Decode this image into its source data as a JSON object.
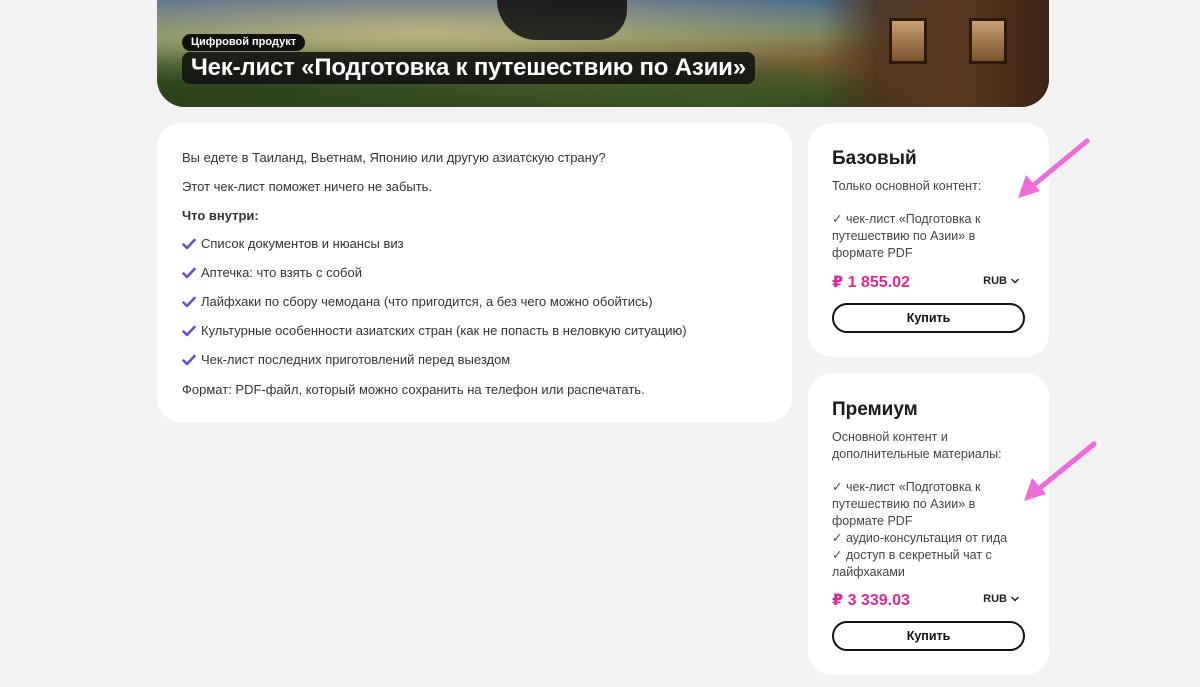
{
  "hero": {
    "tag": "Цифровой продукт",
    "title": "Чек-лист «Подготовка к путешествию по Азии»"
  },
  "description": {
    "intro": "Вы едете в Таиланд, Вьетнам, Японию или другую азиатскую страну?",
    "purpose": "Этот чек-лист поможет ничего не забыть.",
    "inside_heading": "Что внутри:",
    "features": [
      "Список документов и нюансы виз",
      "Аптечка: что взять с собой",
      "Лайфхаки по сбору чемодана (что пригодится, а без чего можно обойтись)",
      "Культурные особенности азиатских стран (как не попасть в неловкую ситуацию)",
      "Чек-лист последних приготовлений перед выездом"
    ],
    "format": "Формат: PDF-файл, который можно сохранить на телефон или распечатать.",
    "check_color": "#6a4fc4"
  },
  "plans": {
    "basic": {
      "title": "Базовый",
      "subtitle": "Только основной контент:",
      "items": [
        "✓ чек-лист «Подготовка к",
        "путешествию по Азии» в",
        "формате PDF"
      ],
      "price": "₽ 1 855.02",
      "currency": "RUB",
      "buy_label": "Купить"
    },
    "premium": {
      "title": "Премиум",
      "subtitle_lines": [
        "Основной контент и",
        "дополнительные материалы:"
      ],
      "items": [
        "✓ чек-лист «Подготовка к",
        "путешествию по Азии» в",
        "формате PDF",
        "✓ аудио-консультация от гида",
        "✓ доступ в секретный чат с",
        "лайфхаками"
      ],
      "price": "₽ 3 339.03",
      "currency": "RUB",
      "buy_label": "Купить"
    }
  },
  "colors": {
    "price": "#e0269a",
    "arrow": "#f06ad8",
    "background": "#f2f2f2"
  }
}
